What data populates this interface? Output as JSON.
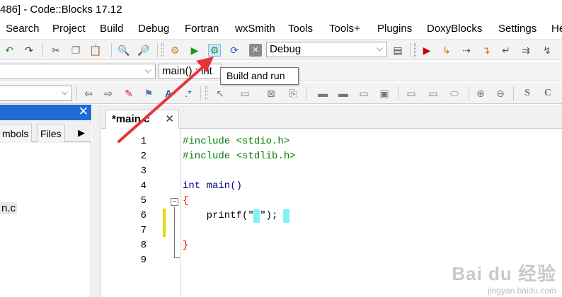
{
  "window": {
    "title": "486] - Code::Blocks 17.12"
  },
  "menu": {
    "items": [
      "Search",
      "Project",
      "Build",
      "Debug",
      "Fortran",
      "wxSmith",
      "Tools",
      "Tools+",
      "Plugins",
      "DoxyBlocks",
      "Settings",
      "He"
    ]
  },
  "toolbar": {
    "build_target": "Debug",
    "scope_value": "main() : int",
    "tooltip": "Build and run"
  },
  "left_panel": {
    "tabs": [
      "mbols",
      "Files"
    ],
    "tab_more": "▶",
    "tree_items": [
      "",
      "n.c"
    ]
  },
  "editor": {
    "tab_title": "*main.c",
    "tab_close": "✕",
    "line_numbers": [
      "1",
      "2",
      "3",
      "4",
      "5",
      "6",
      "7",
      "8",
      "9"
    ],
    "lines": [
      "#include <stdio.h>",
      "#include <stdlib.h>",
      "",
      "int main()",
      "{",
      "    printf(\" \");",
      "",
      "}",
      ""
    ]
  },
  "watermark": {
    "brand": "Bai du 经验",
    "url": "jingyan.baidu.com"
  },
  "colors": {
    "preprocessor": "#008000",
    "keyword": "#00008b",
    "brace": "#ff0000",
    "string": "#0000ff",
    "highlight": "#7ff2f2",
    "annotation_arrow": "#e8333a",
    "panel_header": "#1e6bd6"
  }
}
